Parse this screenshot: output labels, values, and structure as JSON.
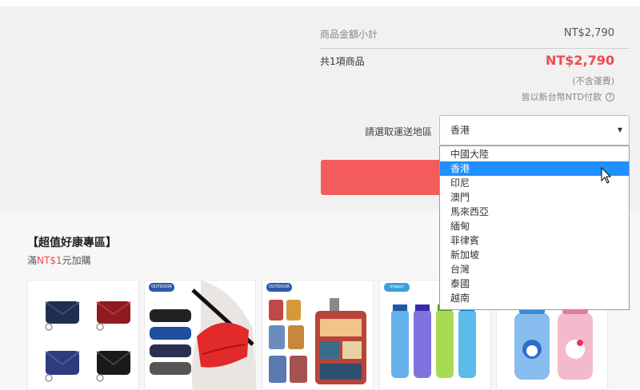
{
  "summary": {
    "subtotal_label": "商品金額小計",
    "subtotal_value": "NT$2,790",
    "total_label": "共1項商品",
    "total_value": "NT$2,790",
    "shipping_note": "(不含運費)",
    "currency_note": "皆以新台幣NTD付款",
    "help_icon": "?"
  },
  "shipping": {
    "label": "請選取運送地區",
    "selected": "香港",
    "options": [
      "中國大陸",
      "香港",
      "印尼",
      "澳門",
      "馬來西亞",
      "緬甸",
      "菲律賓",
      "新加坡",
      "台灣",
      "泰國",
      "越南"
    ],
    "highlighted_index": 1
  },
  "promo": {
    "title": "【超值好康專區】",
    "sub_prefix": "滿",
    "sub_amount": "NT$1",
    "sub_suffix": "元加購"
  },
  "products": [
    {
      "name": "small-pouch-set-product",
      "brand": ""
    },
    {
      "name": "waist-bag-product",
      "brand": "OUTDOOR"
    },
    {
      "name": "luggage-cover-product",
      "brand": "OUTDOOR"
    },
    {
      "name": "water-bottle-set-product",
      "brand": "Impact"
    },
    {
      "name": "kids-bottle-product",
      "brand": ""
    }
  ],
  "colors": {
    "accent_red": "#f5484b",
    "checkout_button": "#f45b5b",
    "dropdown_highlight": "#1e90ff"
  }
}
